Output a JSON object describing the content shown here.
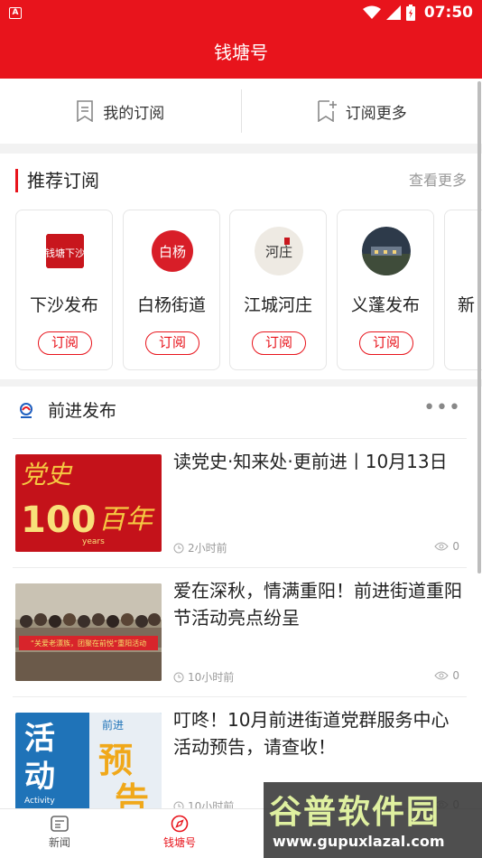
{
  "status_bar": {
    "time": "07:50"
  },
  "header": {
    "title": "钱塘号"
  },
  "subscribe_bar": {
    "my_subscriptions": "我的订阅",
    "subscribe_more": "订阅更多"
  },
  "recommended": {
    "title": "推荐订阅",
    "more": "查看更多",
    "cards": [
      {
        "name": "下沙发布",
        "logo_text": "钱塘下沙",
        "button": "订阅"
      },
      {
        "name": "白杨街道",
        "logo_text": "白杨",
        "button": "订阅"
      },
      {
        "name": "江城河庄",
        "logo_text": "河庄",
        "button": "订阅"
      },
      {
        "name": "义蓬发布",
        "button": "订阅"
      },
      {
        "name": "新"
      }
    ]
  },
  "feed": {
    "channel": "前进发布",
    "items": [
      {
        "title": "读党史·知来处·更前进丨10月13日",
        "time": "2小时前",
        "views": "0",
        "thumb_text_top": "党史",
        "thumb_text_big": "100",
        "thumb_text_side": "百年",
        "thumb_text_small": "years"
      },
      {
        "title": "爱在深秋，情满重阳！前进街道重阳节活动亮点纷呈",
        "time": "10小时前",
        "views": "0",
        "thumb_banner": "“关爱老漂族，团聚在前悦”重阳活动"
      },
      {
        "title": "叮咚！10月前进街道党群服务中心活动预告，请查收！",
        "time": "10小时前",
        "views": "0",
        "thumb_left_top": "活",
        "thumb_left_bottom": "动",
        "thumb_right_top": "预",
        "thumb_right_bottom": "告",
        "thumb_badge": "前进",
        "thumb_sub": "Activity"
      }
    ]
  },
  "tabbar": {
    "news": "新闻",
    "qiantang": "钱塘号"
  },
  "watermark": {
    "line1": "谷普软件园",
    "line2": "www.gupuxlazal.com"
  },
  "colors": {
    "brand_red": "#e8141c",
    "text_dark": "#222222",
    "text_gray": "#999999"
  }
}
